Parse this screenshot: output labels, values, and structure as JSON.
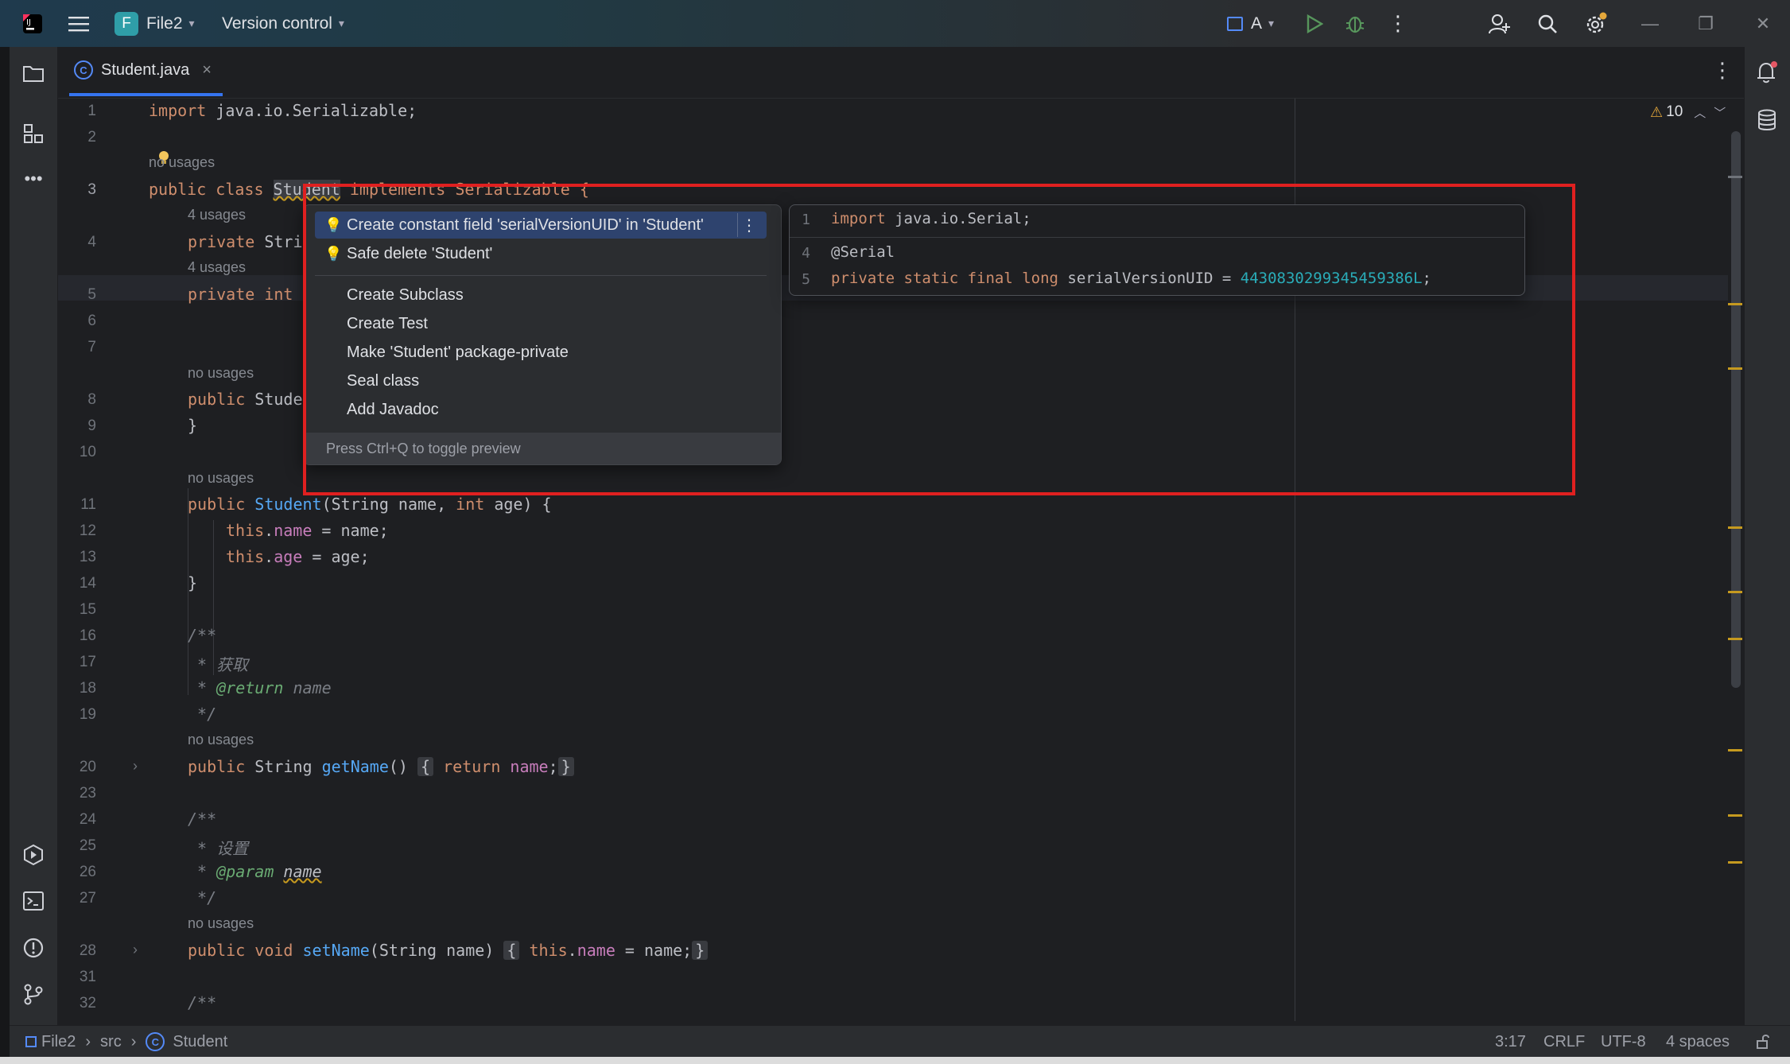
{
  "titlebar": {
    "project_letter": "F",
    "project_name": "File2",
    "vcs_label": "Version control",
    "run_config": "A"
  },
  "tab": {
    "label": "Student.java",
    "close": "×"
  },
  "editor": {
    "warnings_count": "10",
    "lines": [
      {
        "n": "1"
      },
      {
        "n": "2"
      },
      {
        "n": "3"
      },
      {
        "n": "4"
      },
      {
        "n": "5"
      },
      {
        "n": "6"
      },
      {
        "n": "7"
      },
      {
        "n": "8"
      },
      {
        "n": "9"
      },
      {
        "n": "10"
      },
      {
        "n": "11"
      },
      {
        "n": "12"
      },
      {
        "n": "13"
      },
      {
        "n": "14"
      },
      {
        "n": "15"
      },
      {
        "n": "16"
      },
      {
        "n": "17"
      },
      {
        "n": "18"
      },
      {
        "n": "19"
      },
      {
        "n": "20"
      },
      {
        "n": "23"
      },
      {
        "n": "24"
      },
      {
        "n": "25"
      },
      {
        "n": "26"
      },
      {
        "n": "27"
      },
      {
        "n": "28"
      },
      {
        "n": "31"
      },
      {
        "n": "32"
      }
    ],
    "hints": {
      "no_usages": "no usages",
      "four_usages": "4 usages"
    },
    "code": {
      "l1_kw": "import",
      "l1_rest": " java.io.Serializable;",
      "l3_kw": "public class ",
      "l3_name": "Student",
      "l3_rest": " implements Serializable {",
      "l4_kw": "private ",
      "l4_rest": "Stri",
      "l5_kw": "private int",
      "l8_kw": "public ",
      "l8_rest": "Stude",
      "l9": "}",
      "l11_kw": "public ",
      "l11_fn": "Student",
      "l11_a": "(String name, ",
      "l11_int": "int",
      "l11_b": " age) {",
      "l12_this": "this",
      "l12_dot": ".",
      "l12_fld": "name",
      "l12_rest": " = name;",
      "l13_this": "this",
      "l13_dot": ".",
      "l13_fld": "age",
      "l13_rest": " = age;",
      "l14": "}",
      "l16": "/**",
      "l17": " * 获取",
      "l18_a": " * ",
      "l18_tag": "@return",
      "l18_b": " name",
      "l19": " */",
      "l20_kw": "public ",
      "l20_type": "String ",
      "l20_fn": "getName",
      "l20_paren": "()",
      "l20_lb": "{",
      "l20_ret": " return ",
      "l20_fld": "name",
      "l20_semi": ";",
      "l20_rb": "}",
      "l24": "/**",
      "l25": " * 设置",
      "l26_a": " * ",
      "l26_tag": "@param",
      "l26_b": " ",
      "l26_param": "name",
      "l27": " */",
      "l28_kw": "public void ",
      "l28_fn": "setName",
      "l28_rest": "(String name)",
      "l28_lb": "{",
      "l28_this": " this",
      "l28_dot": ".",
      "l28_fld": "name",
      "l28_tail": " = name;",
      "l28_rb": "}",
      "l32": "/**"
    }
  },
  "popup": {
    "items": [
      {
        "label": "Create constant field 'serialVersionUID' in 'Student'"
      },
      {
        "label": "Safe delete 'Student'"
      },
      {
        "label": "Create Subclass"
      },
      {
        "label": "Create Test"
      },
      {
        "label": "Make 'Student' package-private"
      },
      {
        "label": "Seal class"
      },
      {
        "label": "Add Javadoc"
      }
    ],
    "footer": "Press Ctrl+Q to toggle preview"
  },
  "preview": {
    "lines": [
      {
        "n": "1",
        "kw": "import",
        "rest": " java.io.Serial;"
      },
      {
        "n": "4",
        "ann": "@Serial"
      },
      {
        "n": "5",
        "kw": "private static final long ",
        "rest": "serialVersionUID = ",
        "num": "4430830299345459386L",
        "tail": ";"
      }
    ]
  },
  "statusbar": {
    "breadcrumb": [
      "File2",
      "src",
      "Student"
    ],
    "position": "3:17",
    "line_sep": "CRLF",
    "encoding": "UTF-8",
    "indent": "4 spaces"
  },
  "colors": {
    "accent": "#3574f0",
    "selection": "#2e436e",
    "warning": "#c69a1f",
    "annotation_box": "#e02020"
  }
}
